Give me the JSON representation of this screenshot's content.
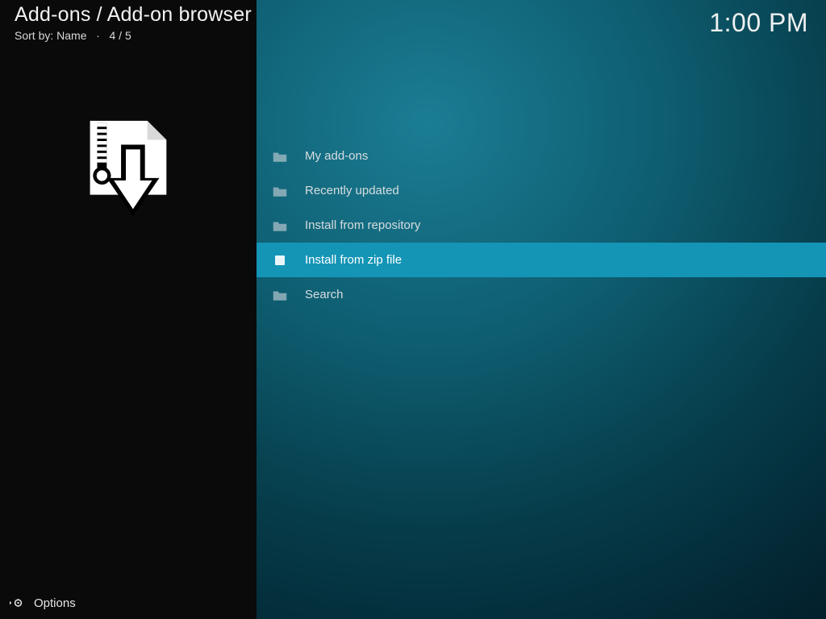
{
  "header": {
    "breadcrumb": "Add-ons / Add-on browser",
    "sort_label": "Sort by: Name",
    "position": "4 / 5"
  },
  "clock": "1:00 PM",
  "list": {
    "items": [
      {
        "label": "My add-ons",
        "icon": "folder",
        "selected": false
      },
      {
        "label": "Recently updated",
        "icon": "folder",
        "selected": false
      },
      {
        "label": "Install from repository",
        "icon": "folder",
        "selected": false
      },
      {
        "label": "Install from zip file",
        "icon": "file",
        "selected": true
      },
      {
        "label": "Search",
        "icon": "folder",
        "selected": false
      }
    ]
  },
  "options": {
    "label": "Options"
  }
}
